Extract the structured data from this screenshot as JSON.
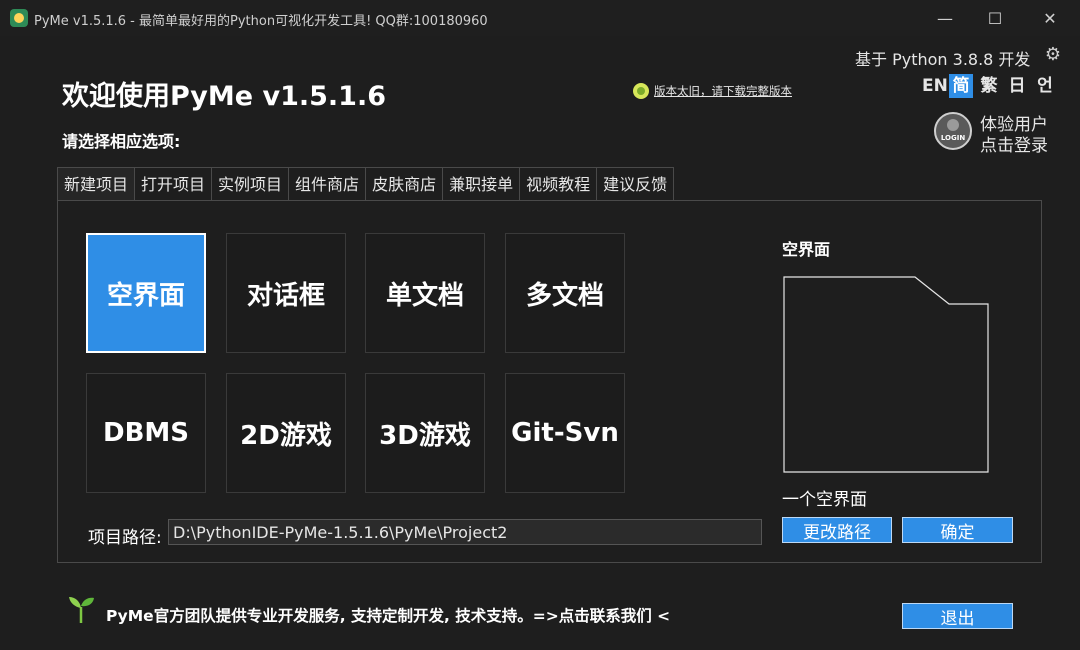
{
  "window": {
    "title": "PyMe v1.5.1.6 - 最简单最好用的Python可视化开发工具! QQ群:100180960",
    "minimize": "—",
    "maximize": "☐",
    "close": "✕"
  },
  "header": {
    "welcome": "欢迎使用PyMe v1.5.1.6",
    "choose_prompt": "请选择相应选项:",
    "notice": "版本太旧，请下载完整版本",
    "based_on": "基于 Python 3.8.8 开发",
    "languages": [
      {
        "label": "EN",
        "active": false
      },
      {
        "label": "简",
        "active": true
      },
      {
        "label": "繁",
        "active": false
      },
      {
        "label": "日",
        "active": false
      },
      {
        "label": "언",
        "active": false
      }
    ]
  },
  "user": {
    "avatar_text": "LOGIN",
    "line1": "体验用户",
    "line2": "点击登录"
  },
  "tabs": [
    {
      "label": "新建项目",
      "active": true
    },
    {
      "label": "打开项目",
      "active": false
    },
    {
      "label": "实例项目",
      "active": false
    },
    {
      "label": "组件商店",
      "active": false
    },
    {
      "label": "皮肤商店",
      "active": false
    },
    {
      "label": "兼职接单",
      "active": false
    },
    {
      "label": "视频教程",
      "active": false
    },
    {
      "label": "建议反馈",
      "active": false
    }
  ],
  "templates": [
    {
      "label": "空界面",
      "selected": true
    },
    {
      "label": "对话框",
      "selected": false
    },
    {
      "label": "单文档",
      "selected": false
    },
    {
      "label": "多文档",
      "selected": false
    },
    {
      "label": "DBMS",
      "selected": false
    },
    {
      "label": "2D游戏",
      "selected": false
    },
    {
      "label": "3D游戏",
      "selected": false
    },
    {
      "label": "Git-Svn",
      "selected": false
    }
  ],
  "preview": {
    "title": "空界面",
    "description": "一个空界面"
  },
  "project": {
    "path_label": "项目路径:",
    "path_value": "D:\\PythonIDE-PyMe-1.5.1.6\\PyMe\\Project2",
    "change_path_label": "更改路径",
    "confirm_label": "确定"
  },
  "footer": {
    "text": "PyMe官方团队提供专业开发服务, 支持定制开发, 技术支持。=>点击联系我们 <",
    "exit_label": "退出"
  },
  "colors": {
    "background": "#1e1e1e",
    "accent": "#2f8ee6",
    "text": "#ffffff"
  }
}
